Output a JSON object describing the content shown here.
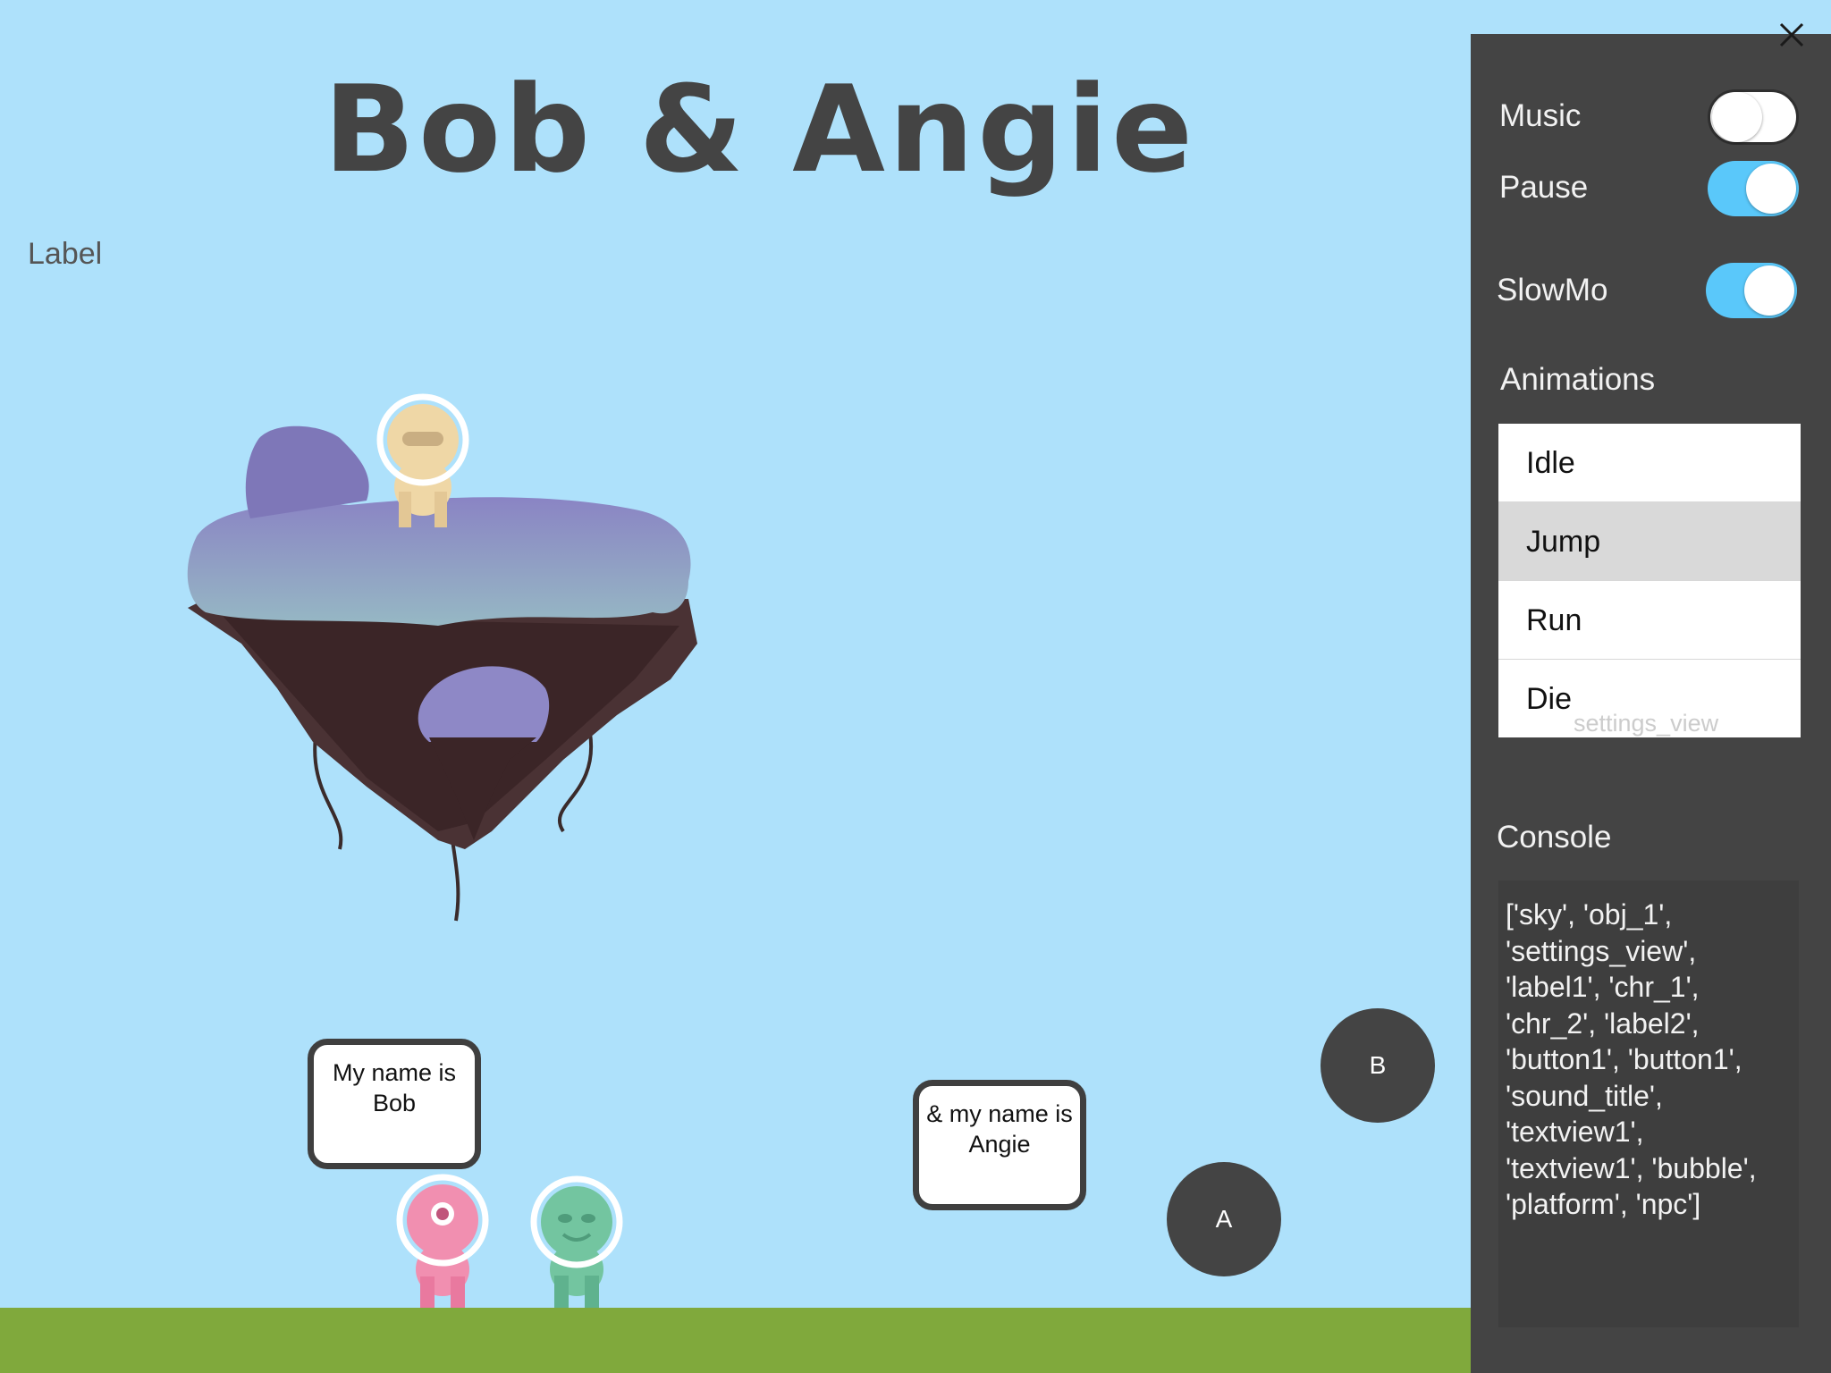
{
  "scene": {
    "title": "Bob & Angie",
    "label1": "Label",
    "bubble_bob": "My name is\nBob",
    "bubble_angie": "& my name is\nAngie",
    "button_b": "B",
    "button_a": "A"
  },
  "settings": {
    "music_label": "Music",
    "music_on": false,
    "pause_label": "Pause",
    "pause_on": true,
    "slowmo_label": "SlowMo",
    "slowmo_on": true,
    "animations_label": "Animations",
    "animations": [
      "Idle",
      "Jump",
      "Run",
      "Die"
    ],
    "selected_animation": "Jump",
    "view_name": "settings_view",
    "console_label": "Console",
    "console_text": "['sky', 'obj_1',\n'settings_view',\n'label1', 'chr_1',\n'chr_2', 'label2',\n'button1', 'button1',\n'sound_title',\n'textview1',\n'textview1', 'bubble',\n'platform', 'npc']"
  },
  "colors": {
    "sky": "#aee1fb",
    "ground": "#80a93c",
    "panel": "#444444",
    "toggle_on": "#5ac8fa"
  },
  "icons": {
    "close": "close-icon"
  }
}
